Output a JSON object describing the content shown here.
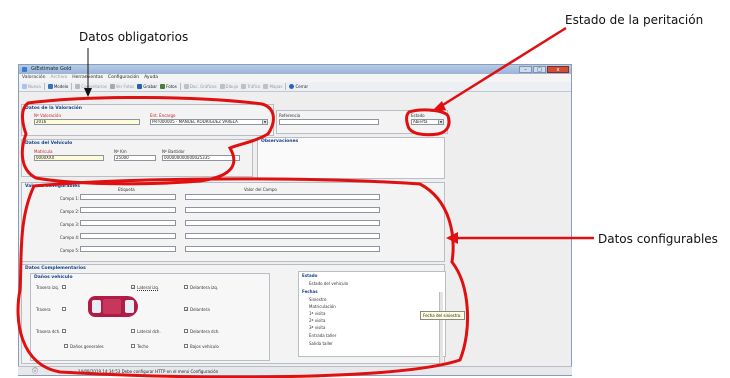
{
  "callouts": {
    "datos_obligatorios": "Datos obligatorios",
    "estado_peritacion": "Estado de la peritación",
    "datos_configurables": "Datos configurables"
  },
  "window": {
    "title": "GiEstimate Gold",
    "minimize": "–",
    "maximize": "□",
    "close": "x"
  },
  "menu": {
    "items": [
      "Valoración",
      "Archivo",
      "Herramientas",
      "Configuración",
      "Ayuda"
    ]
  },
  "toolbar": {
    "buttons": [
      {
        "label": "Nueva",
        "enabled": false,
        "icon": "new-document-icon"
      },
      {
        "label": "Modelo",
        "enabled": true,
        "icon": "car-model-icon"
      },
      {
        "label": "Comentarios",
        "enabled": false,
        "icon": "comments-icon"
      },
      {
        "label": "Ver Fotos",
        "enabled": false,
        "icon": "camera-icon"
      },
      {
        "label": "Grabar",
        "enabled": true,
        "icon": "save-icon"
      },
      {
        "label": "Fotos",
        "enabled": true,
        "icon": "photo-icon"
      },
      {
        "label": "Doc. Gráficos",
        "enabled": false,
        "icon": "graphics-icon"
      },
      {
        "label": "Dibujo",
        "enabled": false,
        "icon": "draw-icon"
      },
      {
        "label": "Tráfico",
        "enabled": false,
        "icon": "traffic-icon"
      },
      {
        "label": "Mapas",
        "enabled": false,
        "icon": "map-icon"
      },
      {
        "label": "Cerrar",
        "enabled": true,
        "icon": "close-icon"
      }
    ]
  },
  "valoracion": {
    "title": "Datos de la Valoración",
    "num_label": "Nº Valoración",
    "num_value": "2016",
    "ent_label": "Ent. Encargo",
    "ent_value": "PRT000005 - MANUEL RODRIGUEZ VARELA",
    "ref_label": "Referencia",
    "ref_value": "",
    "estado_label": "Estado",
    "estado_value": "Abierta"
  },
  "vehiculo": {
    "title": "Datos del Vehículo",
    "matricula_label": "Matrícula",
    "matricula_value": "0000XXX",
    "km_label": "Nº Km",
    "km_value": "25000",
    "bastidor_label": "Nº Bastidor",
    "bastidor_value": "000000000000025335"
  },
  "observaciones": {
    "title": "Observaciones",
    "value": ""
  },
  "configurables": {
    "title": "Valores configurables",
    "col_etiqueta": "Etiqueta",
    "col_valor": "Valor del Campo",
    "rows": [
      {
        "label": "Campo 1:",
        "etiqueta": "",
        "valor": ""
      },
      {
        "label": "Campo 2:",
        "etiqueta": "",
        "valor": ""
      },
      {
        "label": "Campo 3:",
        "etiqueta": "",
        "valor": ""
      },
      {
        "label": "Campo 4:",
        "etiqueta": "",
        "valor": ""
      },
      {
        "label": "Campo 5:",
        "etiqueta": "",
        "valor": ""
      }
    ]
  },
  "complementarios": {
    "title": "Datos Complementarios",
    "danos_title": "Daños vehículo",
    "checks": {
      "trasera_izq": {
        "label": "Trasera izq.",
        "checked": false
      },
      "lateral_izq": {
        "label": "Lateral izq.",
        "checked": true
      },
      "delantera_izq": {
        "label": "Delantera izq.",
        "checked": false
      },
      "trasera": {
        "label": "Trasera",
        "checked": false
      },
      "delantera": {
        "label": "Delantera",
        "checked": true
      },
      "trasera_dch": {
        "label": "Trasera dch.",
        "checked": false
      },
      "lateral_dch": {
        "label": "Lateral dch.",
        "checked": false
      },
      "delantera_dch": {
        "label": "Delantera dch.",
        "checked": false
      },
      "danos_generales": {
        "label": "Daños generales",
        "checked": false
      },
      "techo": {
        "label": "Techo",
        "checked": false
      },
      "bajos_vehiculo": {
        "label": "Bajos vehículo",
        "checked": false
      }
    }
  },
  "estado_grid": {
    "section1": "Estado",
    "row1": "Estado del vehículo",
    "section2": "Fechas",
    "rows2": [
      "Siniestro",
      "Matriculación",
      "1ª visita",
      "2ª visita",
      "3ª visita",
      "Entrada taller",
      "Salida taller"
    ],
    "tooltip": "Fecha del siniestro."
  },
  "statusbar": {
    "text": "14/09/2019 14:34:53 Debe configurar HTTP en el menú Configuración"
  },
  "colors": {
    "annotation_red": "#e01010",
    "window_titlebar": "#9ab4d8",
    "car_body": "#b01c45"
  }
}
